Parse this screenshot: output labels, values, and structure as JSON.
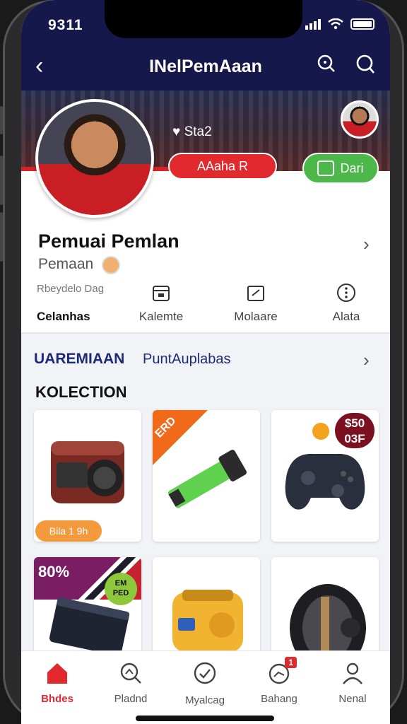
{
  "status": {
    "time": "9311"
  },
  "nav": {
    "title": "INelPemAaan",
    "back_icon": "chevron-left-icon",
    "icons": [
      "search-icon",
      "user-icon"
    ]
  },
  "profile": {
    "stat": "Sta2",
    "red_button": "AAaha R",
    "green_button": "Dari",
    "name": "Pemuai Pemlan",
    "subtitle": "Pemaan",
    "small_label": "Rbeydelo Dag",
    "tabs": [
      {
        "label": "Celanhas",
        "icon": ""
      },
      {
        "label": "Kalemte",
        "icon": "calendar-icon"
      },
      {
        "label": "Molaare",
        "icon": "edit-icon"
      },
      {
        "label": "Alata",
        "icon": "more-icon"
      }
    ]
  },
  "section": {
    "title": "UAREMIAAN",
    "subtitle": "PuntAuplabas"
  },
  "collection": {
    "title": "KOLECTION",
    "cards": [
      {
        "badge": "Bila 1 9h",
        "icon": "speaker-icon"
      },
      {
        "ribbon": "ERD",
        "icon": "gpu-icon"
      },
      {
        "price": "$50\n03F",
        "icon": "gamepad-icon"
      },
      {
        "percent": "80%",
        "green_badge": "EM\nPED",
        "icon": "console-icon"
      },
      {
        "icon": "handheld-icon"
      },
      {
        "icon": "watch-icon"
      }
    ]
  },
  "bottom_nav": [
    {
      "label": "Bhdes",
      "icon": "home-icon",
      "active": true
    },
    {
      "label": "Pladnd",
      "icon": "search-icon"
    },
    {
      "label": "Myalcag",
      "icon": "chat-icon"
    },
    {
      "label": "Bahang",
      "icon": "bell-icon",
      "badge": "1"
    },
    {
      "label": "Nenal",
      "icon": "profile-icon"
    }
  ]
}
